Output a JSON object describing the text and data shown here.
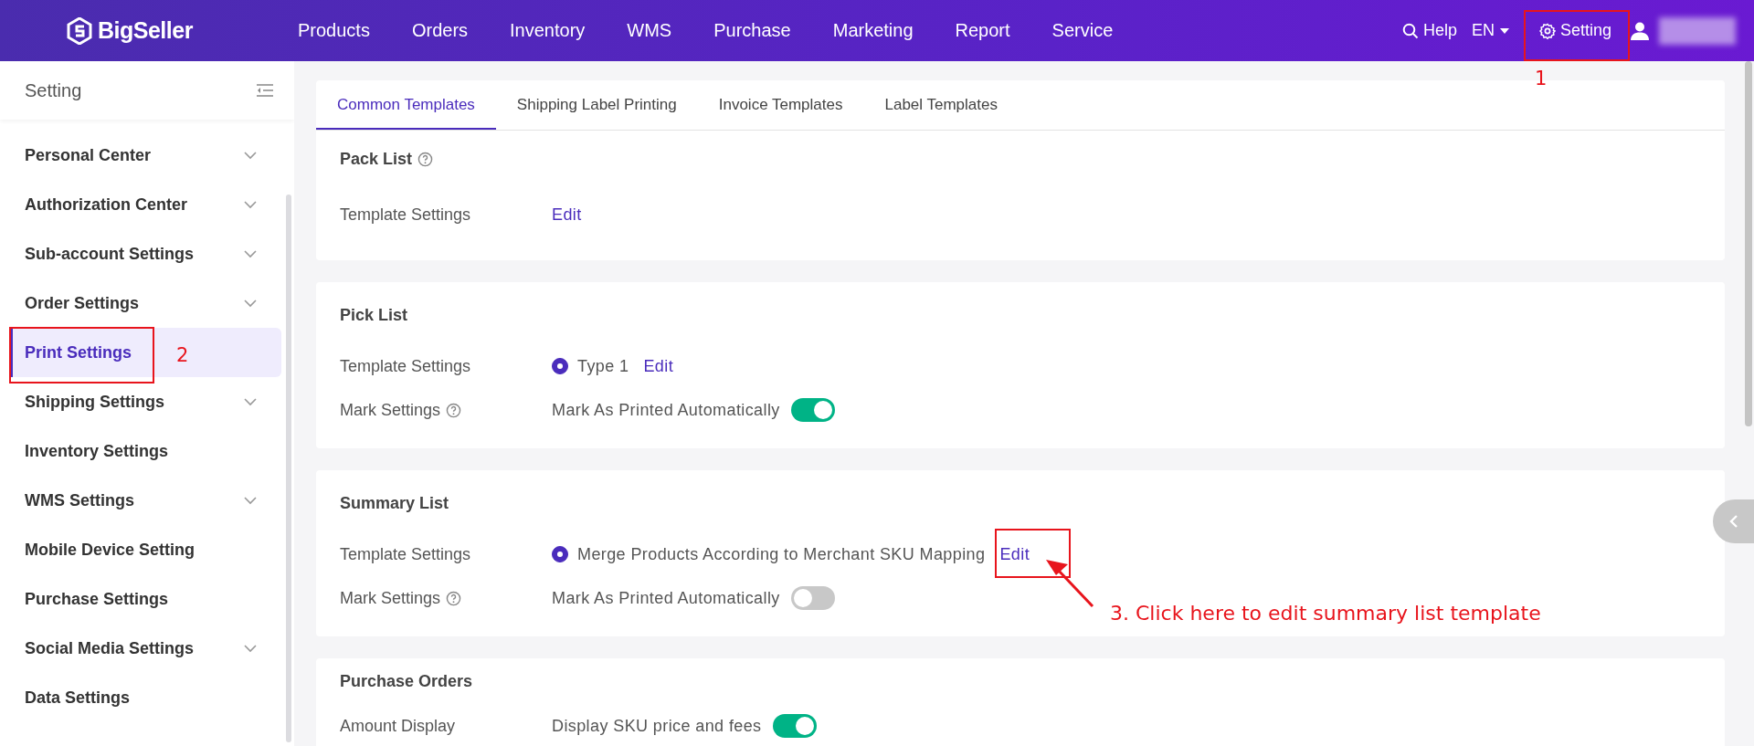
{
  "brand": {
    "name": "BigSeller"
  },
  "nav": [
    {
      "label": "Products"
    },
    {
      "label": "Orders"
    },
    {
      "label": "Inventory"
    },
    {
      "label": "WMS"
    },
    {
      "label": "Purchase"
    },
    {
      "label": "Marketing"
    },
    {
      "label": "Report"
    },
    {
      "label": "Service"
    }
  ],
  "header_right": {
    "help": "Help",
    "language": "EN",
    "setting": "Setting"
  },
  "sidebar": {
    "title": "Setting",
    "items": [
      {
        "label": "Personal Center",
        "expandable": true,
        "selected": false
      },
      {
        "label": "Authorization Center",
        "expandable": true,
        "selected": false
      },
      {
        "label": "Sub-account Settings",
        "expandable": true,
        "selected": false
      },
      {
        "label": "Order Settings",
        "expandable": true,
        "selected": false
      },
      {
        "label": "Print Settings",
        "expandable": false,
        "selected": true
      },
      {
        "label": "Shipping Settings",
        "expandable": true,
        "selected": false
      },
      {
        "label": "Inventory Settings",
        "expandable": false,
        "selected": false
      },
      {
        "label": "WMS Settings",
        "expandable": true,
        "selected": false
      },
      {
        "label": "Mobile Device Setting",
        "expandable": false,
        "selected": false
      },
      {
        "label": "Purchase Settings",
        "expandable": false,
        "selected": false
      },
      {
        "label": "Social Media Settings",
        "expandable": true,
        "selected": false
      },
      {
        "label": "Data Settings",
        "expandable": false,
        "selected": false
      }
    ]
  },
  "tabs": [
    {
      "label": "Common Templates",
      "selected": true
    },
    {
      "label": "Shipping Label Printing",
      "selected": false
    },
    {
      "label": "Invoice Templates",
      "selected": false
    },
    {
      "label": "Label Templates",
      "selected": false
    }
  ],
  "sections": [
    {
      "title": "Pack List",
      "help": true,
      "rows": [
        {
          "label": "Template Settings",
          "help": false,
          "kind": "edit",
          "link": "Edit"
        }
      ]
    },
    {
      "title": "Pick List",
      "help": false,
      "rows": [
        {
          "label": "Template Settings",
          "help": false,
          "kind": "radio",
          "option": "Type 1",
          "selected": true,
          "link": "Edit"
        },
        {
          "label": "Mark Settings",
          "help": true,
          "kind": "toggle",
          "option": "Mark As Printed Automatically",
          "on": true
        }
      ]
    },
    {
      "title": "Summary List",
      "help": false,
      "rows": [
        {
          "label": "Template Settings",
          "help": false,
          "kind": "radio",
          "option": "Merge Products According to Merchant SKU Mapping",
          "selected": true,
          "link": "Edit"
        },
        {
          "label": "Mark Settings",
          "help": true,
          "kind": "toggle",
          "option": "Mark As Printed Automatically",
          "on": false
        }
      ]
    },
    {
      "title": "Purchase Orders",
      "help": false,
      "rows": [
        {
          "label": "Amount Display",
          "help": false,
          "kind": "toggle",
          "option": "Display SKU price and fees",
          "on": true
        }
      ]
    }
  ],
  "annotations": [
    {
      "kind": "number",
      "text": "1"
    },
    {
      "kind": "number",
      "text": "2"
    },
    {
      "kind": "callout",
      "text": "3. Click here to edit summary list template"
    }
  ]
}
